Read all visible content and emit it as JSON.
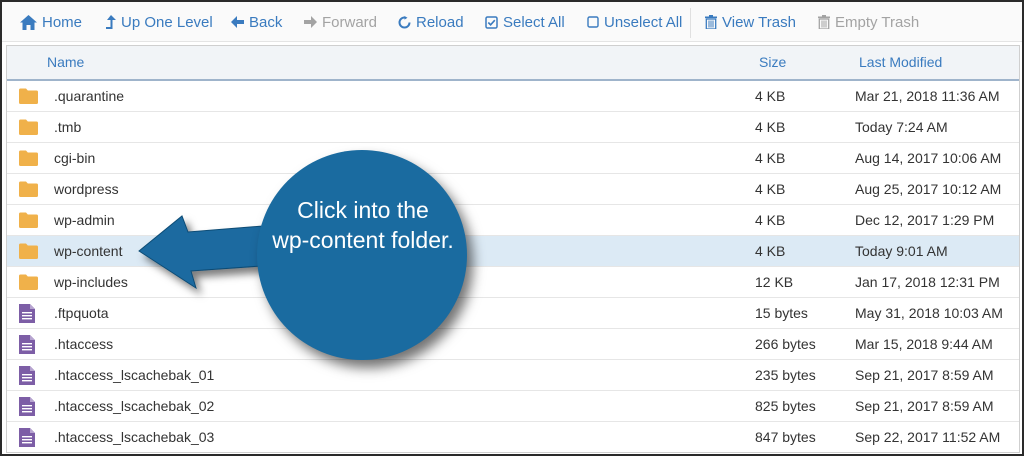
{
  "toolbar": {
    "home": "Home",
    "up": "Up One Level",
    "back": "Back",
    "forward": "Forward",
    "reload": "Reload",
    "select_all": "Select All",
    "unselect_all": "Unselect All",
    "view_trash": "View Trash",
    "empty_trash": "Empty Trash"
  },
  "table": {
    "headers": {
      "name": "Name",
      "size": "Size",
      "modified": "Last Modified"
    },
    "rows": [
      {
        "type": "folder",
        "name": ".quarantine",
        "size": "4 KB",
        "modified": "Mar 21, 2018 11:36 AM"
      },
      {
        "type": "folder",
        "name": ".tmb",
        "size": "4 KB",
        "modified": "Today 7:24 AM"
      },
      {
        "type": "folder",
        "name": "cgi-bin",
        "size": "4 KB",
        "modified": "Aug 14, 2017 10:06 AM"
      },
      {
        "type": "folder",
        "name": "wordpress",
        "size": "4 KB",
        "modified": "Aug 25, 2017 10:12 AM"
      },
      {
        "type": "folder",
        "name": "wp-admin",
        "size": "4 KB",
        "modified": "Dec 12, 2017 1:29 PM"
      },
      {
        "type": "folder",
        "name": "wp-content",
        "size": "4 KB",
        "modified": "Today 9:01 AM",
        "selected": true
      },
      {
        "type": "folder",
        "name": "wp-includes",
        "size": "12 KB",
        "modified": "Jan 17, 2018 12:31 PM"
      },
      {
        "type": "file",
        "name": ".ftpquota",
        "size": "15 bytes",
        "modified": "May 31, 2018 10:03 AM"
      },
      {
        "type": "file",
        "name": ".htaccess",
        "size": "266 bytes",
        "modified": "Mar 15, 2018 9:44 AM"
      },
      {
        "type": "file",
        "name": ".htaccess_lscachebak_01",
        "size": "235 bytes",
        "modified": "Sep 21, 2017 8:59 AM"
      },
      {
        "type": "file",
        "name": ".htaccess_lscachebak_02",
        "size": "825 bytes",
        "modified": "Sep 21, 2017 8:59 AM"
      },
      {
        "type": "file",
        "name": ".htaccess_lscachebak_03",
        "size": "847 bytes",
        "modified": "Sep 22, 2017 11:52 AM"
      }
    ]
  },
  "callout": {
    "line1": "Click into the",
    "line2": "wp-content folder."
  },
  "colors": {
    "link": "#3a7bbf",
    "folder": "#f0b14a",
    "file": "#7d5ea6",
    "selected_row": "#dceaf5",
    "callout": "#1a6ba0"
  },
  "icons": {
    "home": "home-icon",
    "up": "level-up-icon",
    "back": "arrow-left-icon",
    "forward": "arrow-right-icon",
    "reload": "refresh-icon",
    "select_all": "checkbox-checked-icon",
    "unselect_all": "checkbox-empty-icon",
    "view_trash": "trash-icon",
    "empty_trash": "trash-icon",
    "folder": "folder-icon",
    "file": "file-icon"
  }
}
